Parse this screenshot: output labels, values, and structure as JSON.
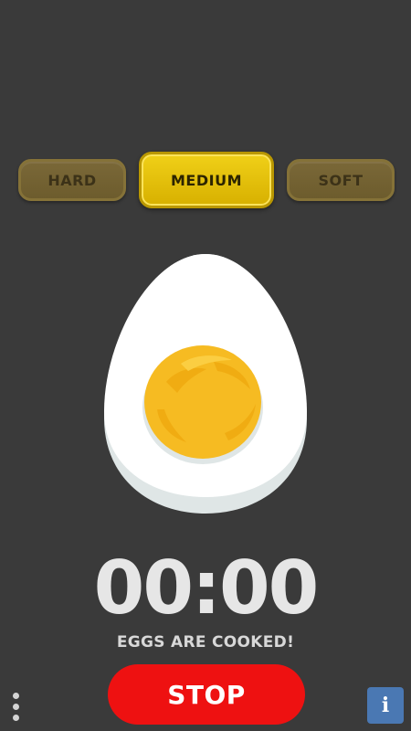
{
  "modes": {
    "hard_label": "HARD",
    "medium_label": "MEDIUM",
    "soft_label": "SOFT",
    "selected": "MEDIUM"
  },
  "timer": {
    "value": "00:00"
  },
  "status": {
    "text": "EGGS ARE COOKED!"
  },
  "actions": {
    "stop_label": "STOP",
    "info_label": "i"
  },
  "icons": {
    "menu": "more-vertical-icon",
    "info": "info-icon",
    "egg": "cooked-egg-icon"
  },
  "colors": {
    "background": "#3a3a3a",
    "active_mode": "#e8c60a",
    "inactive_mode": "#75652f",
    "stop_button": "#ee1111",
    "info_button": "#4a78b3",
    "yolk": "#f6bb22"
  }
}
